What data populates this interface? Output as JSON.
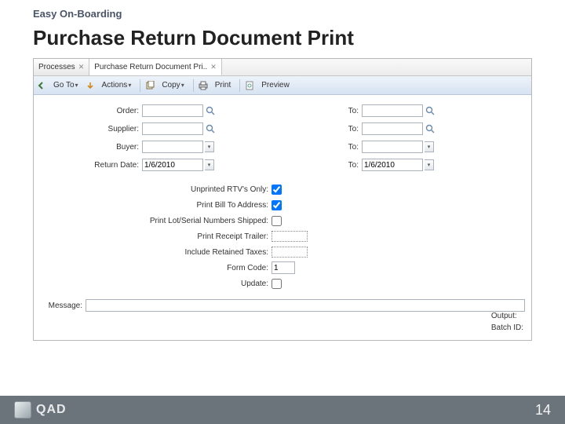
{
  "header": {
    "small": "Easy On-Boarding",
    "title": "Purchase Return Document Print"
  },
  "tabs": {
    "left": "Processes",
    "active": "Purchase Return Document Pri.."
  },
  "toolbar": {
    "goto": "Go To",
    "actions": "Actions",
    "copy": "Copy",
    "print": "Print",
    "preview": "Preview"
  },
  "form": {
    "order_label": "Order:",
    "supplier_label": "Supplier:",
    "buyer_label": "Buyer:",
    "return_date_label": "Return Date:",
    "return_date_value": "1/6/2010",
    "to_label": "To:",
    "to_date_value": "1/6/2010"
  },
  "options": {
    "unprinted_label": "Unprinted RTV's Only:",
    "billto_label": "Print Bill To Address:",
    "lotserial_label": "Print Lot/Serial Numbers Shipped:",
    "receipt_trailer_label": "Print Receipt Trailer:",
    "retained_taxes_label": "Include Retained Taxes:",
    "form_code_label": "Form Code:",
    "form_code_value": "1",
    "update_label": "Update:"
  },
  "message": {
    "label": "Message:"
  },
  "bottom": {
    "output": "Output:",
    "batchid": "Batch ID:"
  },
  "footer": {
    "brand": "QAD",
    "page": "14"
  }
}
